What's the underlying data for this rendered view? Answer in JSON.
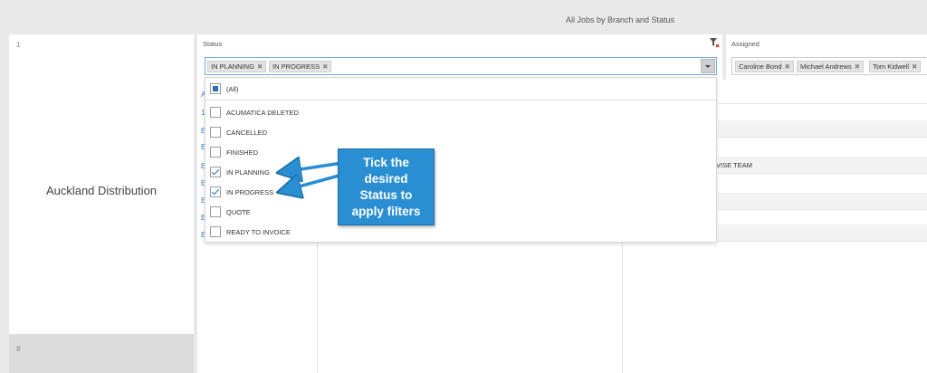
{
  "header": {
    "title": "All Jobs by Branch and Status"
  },
  "left_panel": {
    "row_number_top": "1",
    "branch_name": "Auckland Distribution",
    "row_number_bottom": "8"
  },
  "status_filter": {
    "label": "Status",
    "selected_tags": [
      "IN PLANNING",
      "IN PROGRESS"
    ],
    "tag_remove_glyph": "✖",
    "clear_filter_icon": "filter-clear-icon",
    "options": [
      {
        "label": "(All)",
        "state": "partial"
      },
      {
        "label": "ACUMATICA DELETED",
        "state": "unchecked"
      },
      {
        "label": "CANCELLED",
        "state": "unchecked"
      },
      {
        "label": "FINISHED",
        "state": "unchecked"
      },
      {
        "label": "IN PLANNING",
        "state": "checked"
      },
      {
        "label": "IN PROGRESS",
        "state": "checked"
      },
      {
        "label": "QUOTE",
        "state": "unchecked"
      },
      {
        "label": "READY TO INVOICE",
        "state": "unchecked"
      }
    ]
  },
  "assigned_filter": {
    "label": "Assigned",
    "selected_tags": [
      "Caroline Bond",
      "Michael Andrews",
      "Tom Kidwell"
    ],
    "tag_remove_glyph": "✖"
  },
  "grid": {
    "row_link_chars": [
      "A",
      "1",
      "E",
      "E",
      "E",
      "E",
      "E",
      "E",
      "E"
    ],
    "visible_cell_text": "VISE TEAM"
  },
  "callout": {
    "lines": [
      "Tick the",
      "desired",
      "Status to",
      "apply filters"
    ]
  },
  "colors": {
    "accent": "#2a6ebc",
    "callout": "#2a8fd2",
    "link": "#3a7cc4"
  }
}
